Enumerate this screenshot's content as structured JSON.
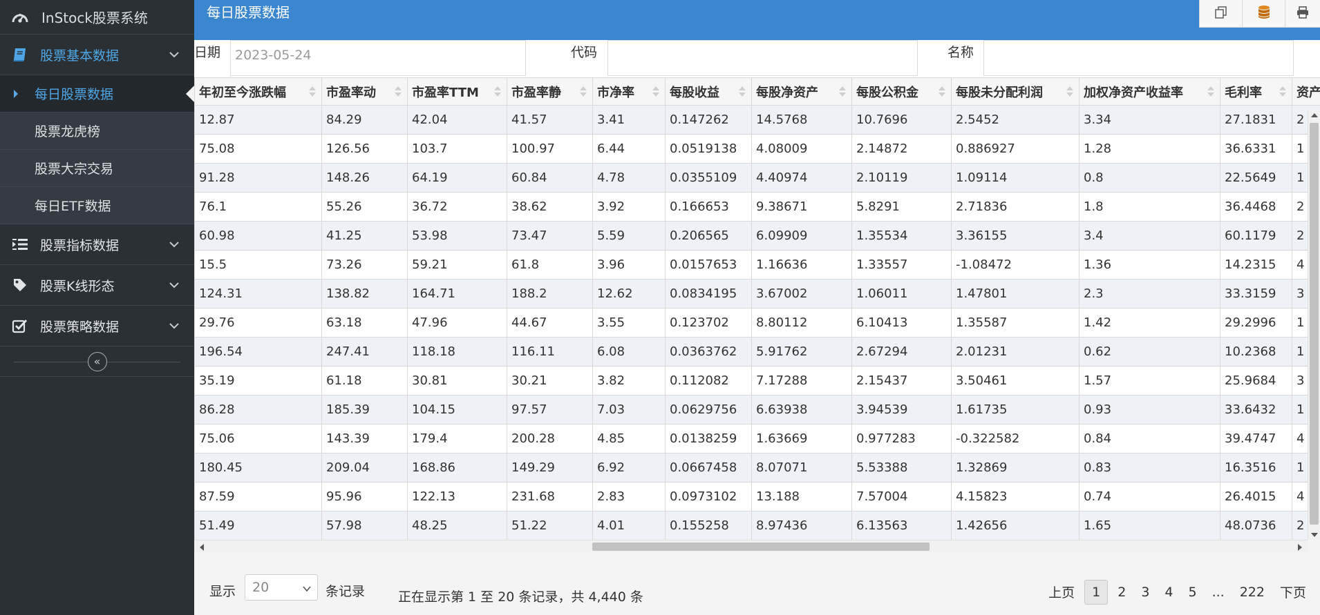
{
  "colors": {
    "sidebar_bg": "#2b3035",
    "header_bg": "#3a86cf",
    "accent": "#4ea6e6",
    "row_alt": "#eef1f5"
  },
  "sidebar": {
    "brand": "InStock股票系统",
    "brand_icon": "dashboard-gauge-icon",
    "items": [
      {
        "label": "股票基本数据",
        "icon": "book-icon",
        "expanded": true
      },
      {
        "label": "股票指标数据",
        "icon": "list-indent-icon",
        "expanded": false
      },
      {
        "label": "股票K线形态",
        "icon": "tag-icon",
        "expanded": false
      },
      {
        "label": "股票策略数据",
        "icon": "checkbox-icon",
        "expanded": false
      }
    ],
    "subitems": [
      "每日股票数据",
      "股票龙虎榜",
      "股票大宗交易",
      "每日ETF数据"
    ],
    "collapse_symbol": "«"
  },
  "header": {
    "title": "每日股票数据",
    "tools": [
      "copy-icon",
      "database-icon",
      "print-icon"
    ]
  },
  "filters": {
    "date_label": "日期",
    "date_value": "2023-05-24",
    "code_label": "代码",
    "code_value": "",
    "name_label": "名称",
    "name_value": ""
  },
  "table": {
    "columns": [
      "年初至今涨跌幅",
      "市盈率动",
      "市盈率TTM",
      "市盈率静",
      "市净率",
      "每股收益",
      "每股净资产",
      "每股公积金",
      "每股未分配利润",
      "加权净资产收益率",
      "毛利率",
      "资产"
    ],
    "rows": [
      [
        "12.87",
        "84.29",
        "42.04",
        "41.57",
        "3.41",
        "0.147262",
        "14.5768",
        "10.7696",
        "2.5452",
        "3.34",
        "27.1831",
        "2"
      ],
      [
        "75.08",
        "126.56",
        "103.7",
        "100.97",
        "6.44",
        "0.0519138",
        "4.08009",
        "2.14872",
        "0.886927",
        "1.28",
        "36.6331",
        "1"
      ],
      [
        "91.28",
        "148.26",
        "64.19",
        "60.84",
        "4.78",
        "0.0355109",
        "4.40974",
        "2.10119",
        "1.09114",
        "0.8",
        "22.5649",
        "1"
      ],
      [
        "76.1",
        "55.26",
        "36.72",
        "38.62",
        "3.92",
        "0.166653",
        "9.38671",
        "5.8291",
        "2.71836",
        "1.8",
        "36.4468",
        "2"
      ],
      [
        "60.98",
        "41.25",
        "53.98",
        "73.47",
        "5.59",
        "0.206565",
        "6.09909",
        "1.35534",
        "3.36155",
        "3.4",
        "60.1179",
        "2"
      ],
      [
        "15.5",
        "73.26",
        "59.21",
        "61.8",
        "3.96",
        "0.0157653",
        "1.16636",
        "1.33557",
        "-1.08472",
        "1.36",
        "14.2315",
        "4"
      ],
      [
        "124.31",
        "138.82",
        "164.71",
        "188.2",
        "12.62",
        "0.0834195",
        "3.67002",
        "1.06011",
        "1.47801",
        "2.3",
        "33.3159",
        "3"
      ],
      [
        "29.76",
        "63.18",
        "47.96",
        "44.67",
        "3.55",
        "0.123702",
        "8.80112",
        "6.10413",
        "1.35587",
        "1.42",
        "29.2996",
        "1"
      ],
      [
        "196.54",
        "247.41",
        "118.18",
        "116.11",
        "6.08",
        "0.0363762",
        "5.91762",
        "2.67294",
        "2.01231",
        "0.62",
        "10.2368",
        "1"
      ],
      [
        "35.19",
        "61.18",
        "30.81",
        "30.21",
        "3.82",
        "0.112082",
        "7.17288",
        "2.15437",
        "3.50461",
        "1.57",
        "25.9684",
        "3"
      ],
      [
        "86.28",
        "185.39",
        "104.15",
        "97.57",
        "7.03",
        "0.0629756",
        "6.63938",
        "3.94539",
        "1.61735",
        "0.93",
        "33.6432",
        "1"
      ],
      [
        "75.06",
        "143.39",
        "179.4",
        "200.28",
        "4.85",
        "0.0138259",
        "1.63669",
        "0.977283",
        "-0.322582",
        "0.84",
        "39.4747",
        "4"
      ],
      [
        "180.45",
        "209.04",
        "168.86",
        "149.29",
        "6.92",
        "0.0667458",
        "8.07071",
        "5.53388",
        "1.32869",
        "0.83",
        "16.3516",
        "1"
      ],
      [
        "87.59",
        "95.96",
        "122.13",
        "231.68",
        "2.83",
        "0.0973102",
        "13.188",
        "7.57004",
        "4.15823",
        "0.74",
        "26.4015",
        "4"
      ],
      [
        "51.49",
        "57.98",
        "48.25",
        "51.22",
        "4.01",
        "0.155258",
        "8.97436",
        "6.13563",
        "1.42656",
        "1.65",
        "48.0736",
        "2"
      ]
    ]
  },
  "footer": {
    "show_label": "显示",
    "page_size": "20",
    "records_label": "条记录",
    "info": "正在显示第 1 至 20 条记录，共 4,440 条",
    "prev": "上页",
    "pages": [
      "1",
      "2",
      "3",
      "4",
      "5",
      "...",
      "222"
    ],
    "current_page": "1",
    "next": "下页"
  }
}
